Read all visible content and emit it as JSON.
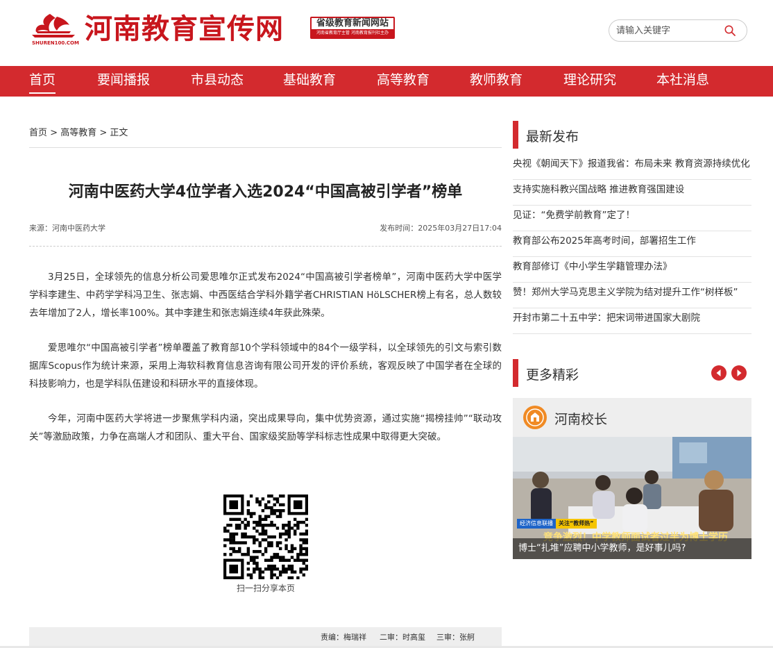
{
  "header": {
    "logo_domain": "SHUREN100.COM",
    "site_title": "河南教育宣传网",
    "badge_main": "省级教育新闻网站",
    "badge_sub": "河南省教育厅主管 河南教育报刊社主办"
  },
  "search": {
    "placeholder": "请输入关键字"
  },
  "nav": {
    "items": [
      {
        "label": "首页",
        "active": true
      },
      {
        "label": "要闻播报"
      },
      {
        "label": "市县动态"
      },
      {
        "label": "基础教育"
      },
      {
        "label": "高等教育"
      },
      {
        "label": "教师教育"
      },
      {
        "label": "理论研究"
      },
      {
        "label": "本社消息"
      }
    ]
  },
  "breadcrumb": [
    "首页",
    "高等教育",
    "正文"
  ],
  "breadcrumb_sep": ">",
  "article": {
    "title": "河南中医药大学4位学者入选2024“中国高被引学者”榜单",
    "source": "来源：河南中医药大学",
    "published": "发布时间：2025年03月27日17:04",
    "paragraphs": [
      "3月25日，全球领先的信息分析公司爱思唯尔正式发布2024“中国高被引学者榜单”，河南中医药大学中医学学科李建生、中药学学科冯卫生、张志娟、中西医结合学科外籍学者CHRISTIAN HöLSCHER榜上有名，总人数较去年增加了2人，增长率100%。其中李建生和张志娟连续4年获此殊荣。",
      "爱思唯尔“中国高被引学者”榜单覆盖了教育部10个学科领域中的84个一级学科，以全球领先的引文与索引数据库Scopus作为统计来源，采用上海软科教育信息咨询有限公司开发的评价系统，客观反映了中国学者在全球的科技影响力，也是学科队伍建设和科研水平的直接体现。",
      "今年，河南中医药大学将进一步聚焦学科内涵，突出成果导向，集中优势资源，通过实施“揭榜挂帅”“联动攻关”等激励政策，力争在高端人才和团队、重大平台、国家级奖励等学科标志性成果中取得更大突破。"
    ],
    "qr_caption": "扫一扫分享本页",
    "editors": {
      "editor": "责编：梅瑞祥",
      "second": "二审：时高玺",
      "third": "三审：张舸"
    }
  },
  "sidebar": {
    "latest_title": "最新发布",
    "latest": [
      "央视《朝闻天下》报道我省：布局未来 教育资源持续优化",
      "支持实施科教兴国战略 推进教育强国建设",
      "见证：“免费学前教育”定了！",
      "教育部公布2025年高考时间，部署招生工作",
      "教育部修订《中小学生学籍管理办法》",
      "赞！郑州大学马克思主义学院为结对提升工作“树样板”",
      "开封市第二十五中学：把宋词带进国家大剧院"
    ],
    "more_title": "更多精彩",
    "feature": {
      "label": "河南校长",
      "caption": "博士“扎堆”应聘中小学教师，是好事儿吗?",
      "tv_tag_1": "经济信息联播",
      "tv_tag_2": "关注“教师热”",
      "tv_headline": "竞争激烈！中学教师面试者过半为博士学历"
    }
  },
  "colors": {
    "brand_red": "#d32a2e",
    "logo_red": "#c8161d"
  }
}
